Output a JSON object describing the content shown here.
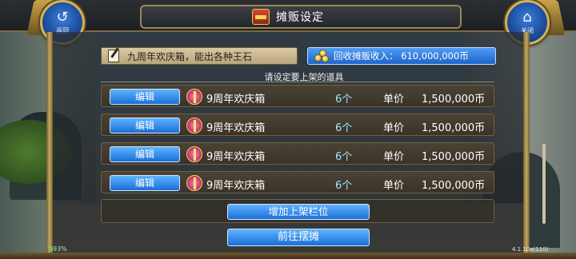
{
  "header": {
    "title": "摊贩设定",
    "back_label": "返回",
    "close_label": "关闭"
  },
  "notice": {
    "text": "九周年欢庆箱，能出各种王石"
  },
  "income": {
    "label": "回收摊贩收入： 610,000,000币"
  },
  "subtitle": "请设定要上架的道具",
  "items": [
    {
      "edit_label": "编辑",
      "name": "9周年欢庆箱",
      "qty": "6个",
      "price_label": "单价",
      "price": "1,500,000币"
    },
    {
      "edit_label": "编辑",
      "name": "9周年欢庆箱",
      "qty": "6个",
      "price_label": "单价",
      "price": "1,500,000币"
    },
    {
      "edit_label": "编辑",
      "name": "9周年欢庆箱",
      "qty": "6个",
      "price_label": "单价",
      "price": "1,500,000币"
    },
    {
      "edit_label": "编辑",
      "name": "9周年欢庆箱",
      "qty": "6个",
      "price_label": "单价",
      "price": "1,500,000币"
    }
  ],
  "actions": {
    "add_slot_label": "增加上架栏位",
    "go_stall_label": "前往摆摊"
  },
  "status": {
    "battery": "93%",
    "version": "4.1.10a(110)"
  },
  "colors": {
    "button_blue": "#1b6fd6",
    "frame_gold": "#c9ab62",
    "qty_cyan": "#9fe6ff"
  }
}
